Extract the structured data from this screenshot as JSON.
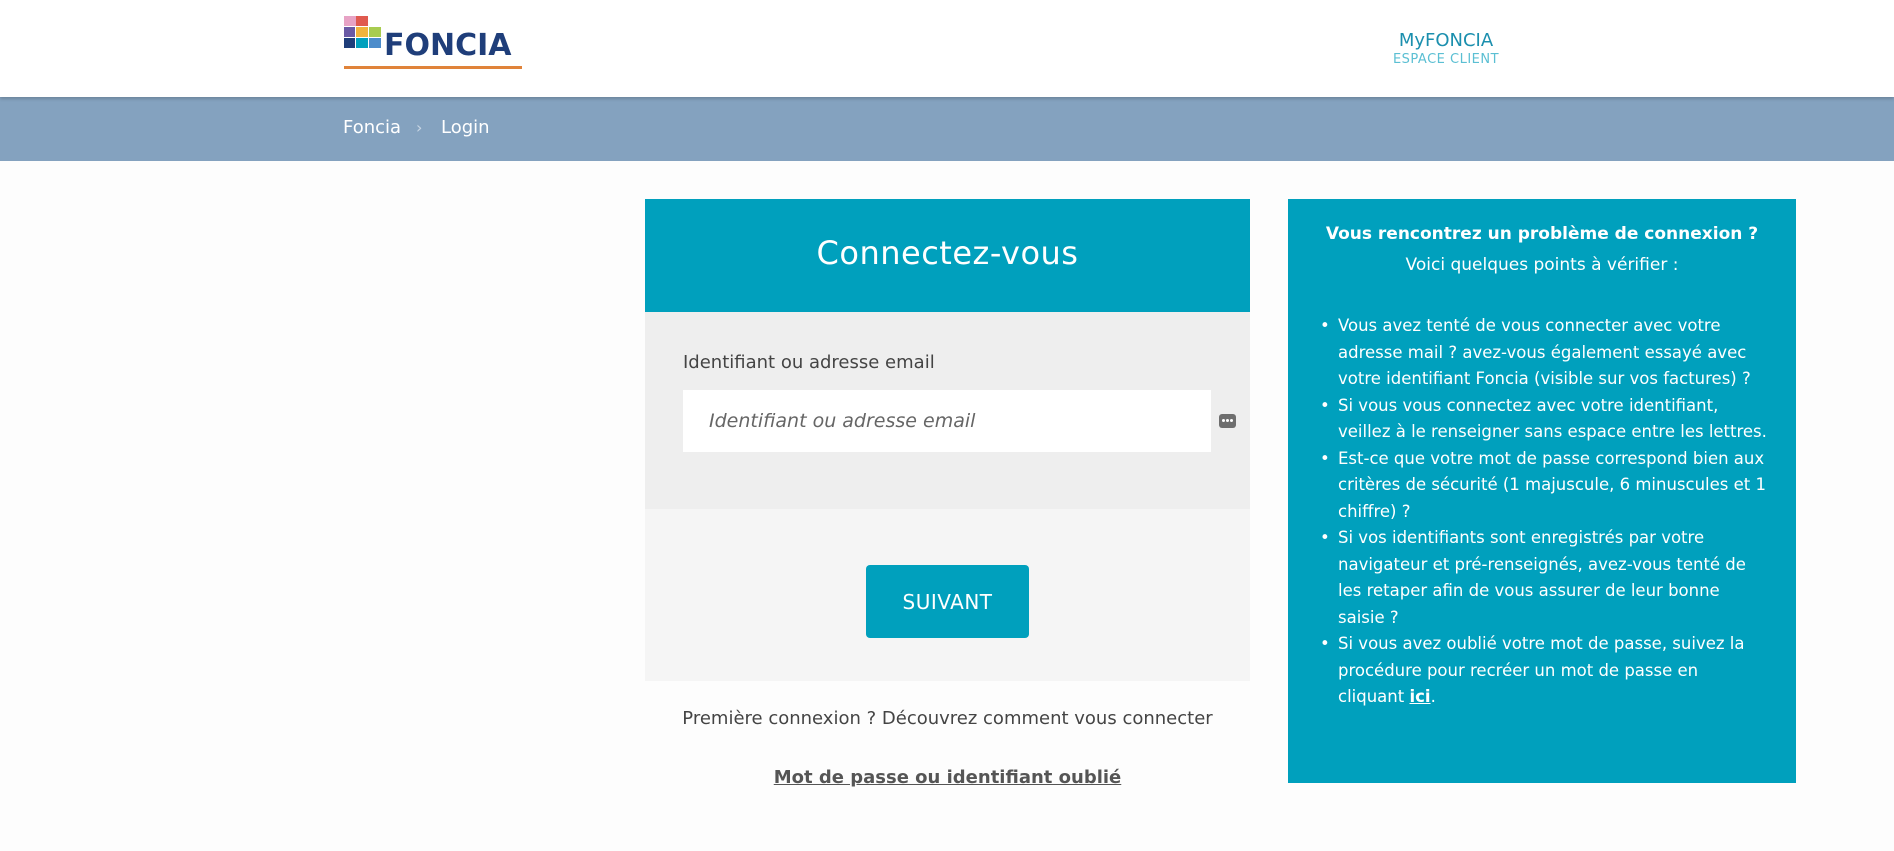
{
  "header": {
    "logo_text": "FONCIA",
    "account_title": "MyFONCIA",
    "account_subtitle": "ESPACE CLIENT"
  },
  "breadcrumb": {
    "items": [
      {
        "label": "Foncia"
      },
      {
        "label": "Login"
      }
    ],
    "separator": "›"
  },
  "login": {
    "title": "Connectez-vous",
    "field_label": "Identifiant ou adresse email",
    "input_placeholder": "Identifiant ou adresse email",
    "input_value": "",
    "submit_label": "SUIVANT",
    "first_login_text": "Première connexion ? Découvrez comment vous connecter",
    "forgot_link": "Mot de passe ou identifiant oublié"
  },
  "help": {
    "title": "Vous rencontrez un problème de connexion ?",
    "subtitle": "Voici quelques points à vérifier :",
    "items": [
      "Vous avez tenté de vous connecter avec votre adresse mail ? avez-vous également essayé avec votre identifiant Foncia (visible sur vos factures) ?",
      "Si vous vous connectez avec votre identifiant, veillez à le renseigner sans espace entre les lettres.",
      "Est-ce que votre mot de passe correspond bien aux critères de sécurité (1 majuscule, 6 minuscules et 1 chiffre) ?",
      "Si vos identifiants sont enregistrés par votre navigateur et pré-renseignés, avez-vous tenté de les retaper afin de vous assurer de leur bonne saisie ?"
    ],
    "last_item_text": "Si vous avez oublié votre mot de passe, suivez la procédure pour recréer un mot de passe en cliquant ",
    "last_item_link": "ici",
    "last_item_end": "."
  },
  "colors": {
    "accent": "#00a0bd",
    "breadcrumb_bar": "#84a2bf",
    "logo_blue": "#1f3e7a",
    "logo_underline": "#e0833a",
    "form_bg": "#eeeeee"
  },
  "icons": {
    "password_manager": "password-dots-icon"
  }
}
